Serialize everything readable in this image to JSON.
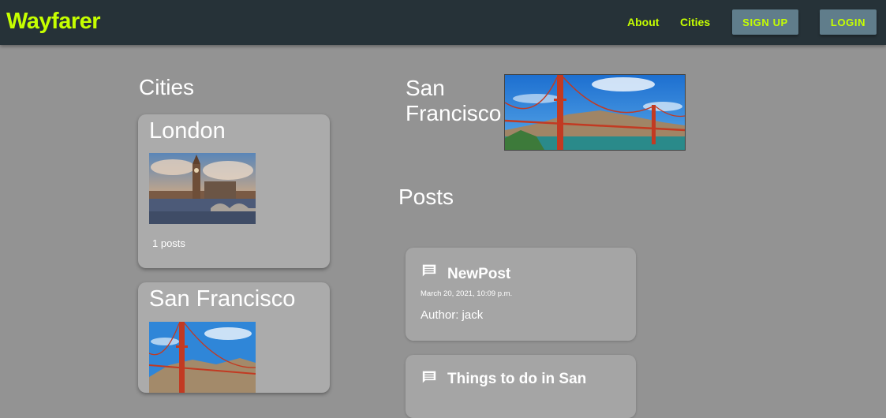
{
  "nav": {
    "brand": "Wayfarer",
    "links": [
      "About",
      "Cities"
    ],
    "signup_label": "SIGN UP",
    "login_label": "LOGIN"
  },
  "sidebar": {
    "title": "Cities",
    "cities": [
      {
        "name": "London",
        "posts_label": "1 posts",
        "image": "big-ben-thames-photo"
      },
      {
        "name": "San Francisco",
        "posts_label": "",
        "image": "golden-gate-bridge-photo"
      }
    ]
  },
  "city_detail": {
    "name_line1": "San",
    "name_line2": "Francisco",
    "image": "golden-gate-bridge-photo"
  },
  "posts": {
    "title": "Posts",
    "items": [
      {
        "title": "NewPost",
        "date": "March 20, 2021, 10:09 p.m.",
        "author": "Author: jack",
        "icon": "comment-icon"
      },
      {
        "title": "Things to do in San",
        "date": "",
        "author": "",
        "icon": "comment-icon"
      }
    ]
  },
  "colors": {
    "accent": "#c6ff00",
    "navbar": "#263238",
    "button": "#607d8b",
    "background": "#939393",
    "card": "#ababab"
  }
}
